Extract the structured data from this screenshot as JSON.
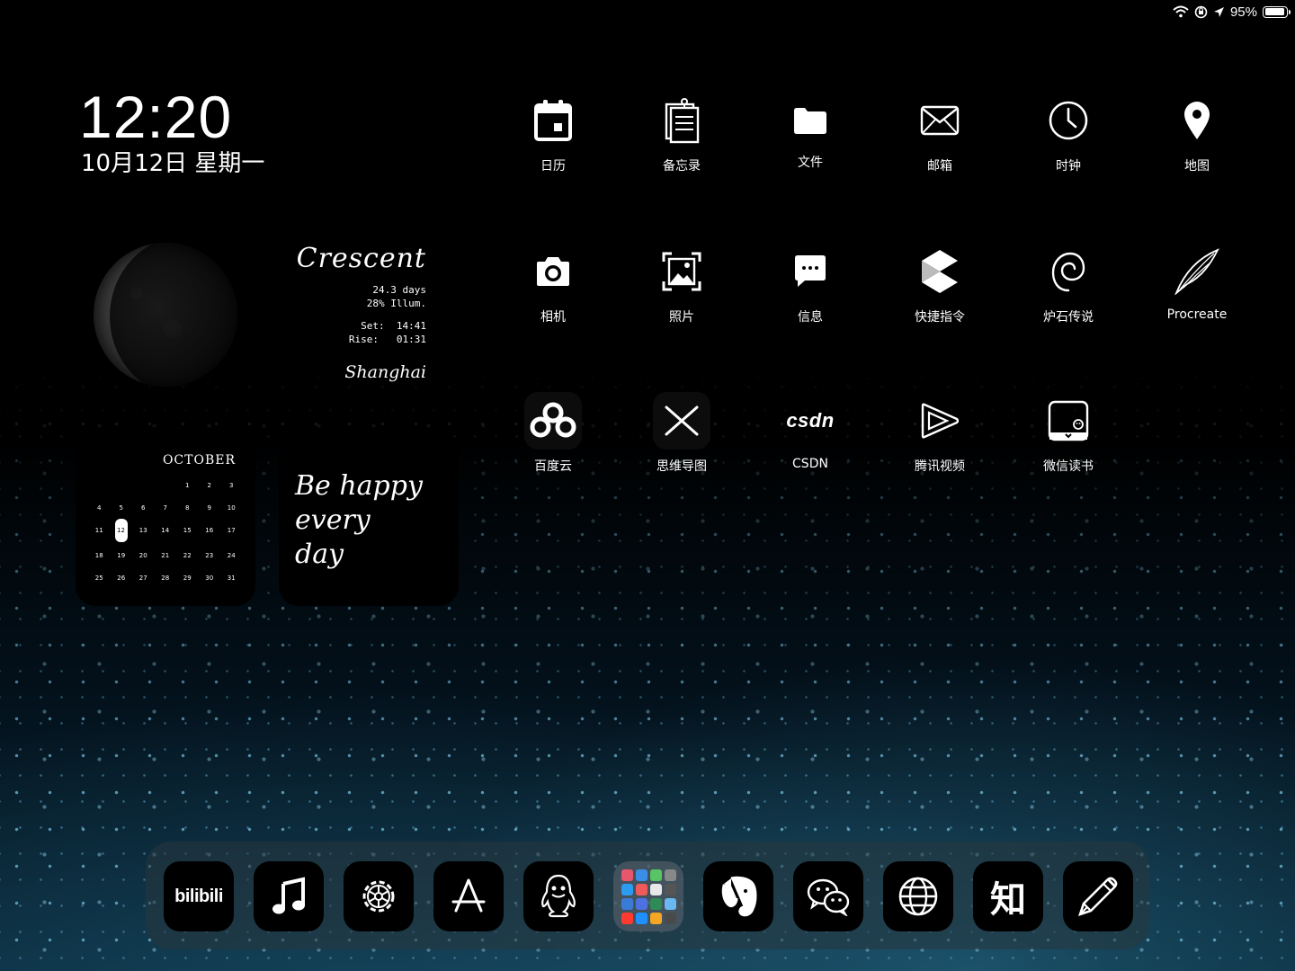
{
  "status_bar": {
    "battery_text": "95%",
    "battery_level": 0.95
  },
  "clock": {
    "time": "12:20",
    "date": "10月12日 星期一"
  },
  "moon_widget": {
    "phase": "Crescent",
    "age": "24.3 days",
    "illumination": "28% Illum.",
    "set_label": "Set:",
    "set_time": "14:41",
    "rise_label": "Rise:",
    "rise_time": "01:31",
    "city": "Shanghai"
  },
  "calendar_widget": {
    "month": "OCTOBER",
    "today": "12",
    "cells": [
      "",
      "",
      "",
      "",
      "1",
      "2",
      "3",
      "4",
      "5",
      "6",
      "7",
      "8",
      "9",
      "10",
      "11",
      "12",
      "13",
      "14",
      "15",
      "16",
      "17",
      "18",
      "19",
      "20",
      "21",
      "22",
      "23",
      "24",
      "25",
      "26",
      "27",
      "28",
      "29",
      "30",
      "31"
    ]
  },
  "note_widget": {
    "line1": "Be happy",
    "line2": "every",
    "line3": "day"
  },
  "apps": [
    {
      "id": "calendar",
      "label": "日历",
      "icon": "calendar-icon"
    },
    {
      "id": "notes",
      "label": "备忘录",
      "icon": "notes-icon"
    },
    {
      "id": "files",
      "label": "文件",
      "icon": "folder-icon"
    },
    {
      "id": "mail",
      "label": "邮箱",
      "icon": "mail-icon"
    },
    {
      "id": "clock",
      "label": "时钟",
      "icon": "clock-icon"
    },
    {
      "id": "maps",
      "label": "地图",
      "icon": "map-pin-icon"
    },
    {
      "id": "camera",
      "label": "相机",
      "icon": "camera-icon"
    },
    {
      "id": "photos",
      "label": "照片",
      "icon": "photo-icon"
    },
    {
      "id": "messages",
      "label": "信息",
      "icon": "message-icon"
    },
    {
      "id": "shortcuts",
      "label": "快捷指令",
      "icon": "shortcuts-icon"
    },
    {
      "id": "hearthstone",
      "label": "炉石传说",
      "icon": "swirl-icon"
    },
    {
      "id": "procreate",
      "label": "Procreate",
      "icon": "brush-icon"
    },
    {
      "id": "baiducloud",
      "label": "百度云",
      "icon": "cloud-icon"
    },
    {
      "id": "mindmap",
      "label": "思维导图",
      "icon": "cross-icon"
    },
    {
      "id": "csdn",
      "label": "CSDN",
      "icon_text": "csdn",
      "icon": "csdn-logo-icon"
    },
    {
      "id": "tencentvideo",
      "label": "腾讯视频",
      "icon": "play-icon"
    },
    {
      "id": "wechatread",
      "label": "微信读书",
      "icon": "book-icon"
    }
  ],
  "dock": {
    "bilibili_text": "bilibili",
    "zhihu_text": "知",
    "items": [
      "bilibili",
      "music",
      "settings",
      "app-store",
      "qq",
      "folder",
      "evernote",
      "wechat",
      "browser",
      "zhihu",
      "notability"
    ]
  },
  "colors": {
    "accent_blue": "#2e7fa6",
    "background": "#000000"
  }
}
